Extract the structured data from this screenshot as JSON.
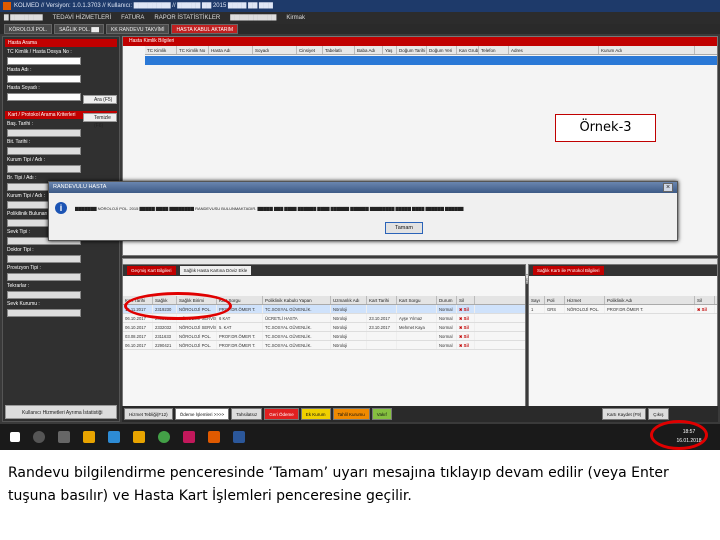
{
  "window": {
    "title": "KOLMED // Versiyon: 1.0.1.3703 // Kullanıcı: ▇▇▇▇▇▇▇▇ // ▇▇▇▇▇ ▇▇ 2015 ▇▇▇▇ ▇▇ ▇▇▇"
  },
  "menu": [
    "▇ ▇▇▇▇▇▇▇",
    "TEDAVİ HİZMETLERİ",
    "FATURA",
    "RAPOR İSTATİSTİKLER",
    "▇▇▇▇▇▇▇▇▇▇",
    "Kirmak"
  ],
  "tabs": [
    "KÖROLOJİ POL.",
    "SAĞLIK POL. ▇▇",
    "KK RANDEVU TAKVİMİ",
    "HASTA KABUL AKTARIM"
  ],
  "left_panel": {
    "header": "Hasta Arama",
    "tc_label": "TC Kimlik / Hasta Dosya No :",
    "name_label": "Hasta Adı :",
    "surname_label": "Hasta Soyadı :",
    "search_btn": "Ara (F5)",
    "clear_btn": "Temizle (F6)",
    "card_header": "Kart / Protokol Arama Kriterleri",
    "fields": [
      "Baş. Tarihi :",
      "Bit. Tarihi :",
      "Kurum Tipi / Adı :",
      "Br. Tipi / Adı :",
      "Kurum Tipi / Adı :",
      "Polikilinik Bulunan",
      "Sevk Tipi :",
      "Doktor Tipi :",
      "Provizyon Tipi :",
      "Tekrarlar :",
      "Sevk Kurumu :"
    ],
    "footer": "Kullanıcı Hizmetleri Ayrıma İstatistiği"
  },
  "top_grid": {
    "panel_title": "Hasta Kimlik Bilgileri",
    "columns": [
      "TC Kimlik",
      "TC Kimlik No",
      "Hasta Adı",
      "Soyadı",
      "Cinsiyet",
      "Tabelatlı",
      "Baba Adı",
      "Yaş",
      "Doğum Tarihi",
      "Doğum Yeri",
      "Kan Grubu",
      "Telefon",
      "Adres",
      "Kurum Adı"
    ]
  },
  "callout": "Örnek-3",
  "dialog": {
    "title": "RANDEVULU HASTA",
    "message": "▇▇▇▇▇▇▇ NÖROLOJİ POL. 2015 ▇▇▇▇▇ ▇▇▇▇ ▇▇▇▇▇▇▇▇ RANDEVUSU BULUNMAKTADIR. ▇▇▇▇▇ ▇▇▇ ▇▇▇▇ ▇▇▇▇▇▇ ▇▇▇▇ ▇▇▇▇▇▇ ▇▇▇▇▇▇ ▇▇▇▇▇▇▇▇ ▇▇▇▇▇ ▇▇▇▇ ▇▇▇▇▇▇ ▇▇▇▇▇▇",
    "ok": "Tamam"
  },
  "mid_buttons": [
    "Hasta Kimlik Barkodu Yazdır (F10)",
    "Hasta Uyarı Ekle",
    "Muayeneye Başla",
    "Tahlil Sonuçları",
    "Epikriz Yazdır",
    "Kart Kapat"
  ],
  "bottom_left": {
    "tabs": [
      "Geçmiş Kart Bilgileri",
      "Sağlık Hasta Kartına Döviz Ekle"
    ],
    "columns": [
      "Kart Tarihi",
      "Sağlık",
      "Sağlık Birimi",
      "Kart Sorgu",
      "Poliklinik Kabulü Yapan",
      "Uzmanlık Adı",
      "Kart Tarihi",
      "Kart Sorgu",
      "Durum",
      "Sil"
    ],
    "rows": [
      [
        "15.11.2017",
        "2319230",
        "NÖROLOJİ POL.",
        "PROF.DR.ÖMER T.",
        "TC.SOSYAL GÜVENLİK.",
        "Nöroloji",
        "",
        "",
        "Normal",
        "✖ Sil"
      ],
      [
        "06.10.2017",
        "2332325",
        "NÖROLOJİ SERVİSİ",
        "6 KAT",
        "ÜCRETLİ HASTA",
        "Nöroloji",
        "23.10.2017",
        "Ayşe Yılmaz",
        "Normal",
        "✖ Sil"
      ],
      [
        "06.10.2017",
        "2332032",
        "NÖROLOJİ SERVİSİ",
        "5. KAT",
        "TC.SOSYAL GÜVENLİK.",
        "Nöroloji",
        "23.10.2017",
        "Mehmet Kaya",
        "Normal",
        "✖ Sil"
      ],
      [
        "03.08.2017",
        "2311633",
        "NÖROLOJİ POL.",
        "PROF.DR.ÖMER T.",
        "TC.SOSYAL GÜVENLİK.",
        "Nöroloji",
        "",
        "",
        "Normal",
        "✖ Sil"
      ],
      [
        "06.10.2017",
        "2290421",
        "NÖROLOJİ POL.",
        "PROF.DR.ÖMER T.",
        "TC.SOSYAL GÜVENLİK.",
        "Nöroloji",
        "",
        "",
        "Normal",
        "✖ Sil"
      ]
    ]
  },
  "bottom_right": {
    "tabs": [
      "Sağlık Kartı ile Protokol Bilgileri"
    ],
    "columns": [
      "Sayı",
      "Poli",
      "Hizmet",
      "Poliklinik Adı",
      "Sil"
    ],
    "row": [
      "1",
      "GRS",
      "NÖROLOJİ POL.",
      "PROF.DR.ÖMER T.",
      "✖ Sil"
    ]
  },
  "footer_bar": [
    "Hizmet Tebliği(F12)",
    "Ödeme İşlemleri >>>>",
    "Tahsilatsız",
    "Geri Ödeme",
    "Ek Kurum",
    "Tahlil Kurumu",
    "Vakıf"
  ],
  "right_footer": [
    "Kartı Kaydet (F9)",
    "Çıkış"
  ],
  "tray": {
    "time": "18:57",
    "date": "16.01.2018"
  },
  "caption": "Randevu bilgilendirme penceresinde ‘Tamam’ uyarı mesajına tıklayıp devam edilir (veya Enter tuşuna basılır) ve Hasta Kart İşlemleri penceresine geçilir."
}
